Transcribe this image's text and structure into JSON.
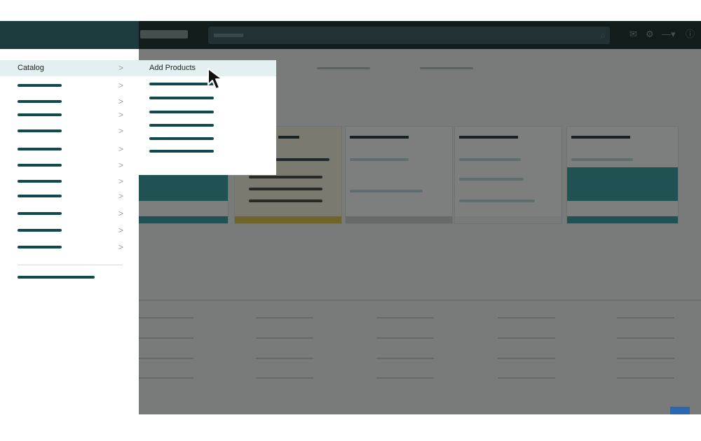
{
  "drawer": {
    "active_item": {
      "label": "Catalog",
      "chevron": ">"
    },
    "items": [
      {
        "chevron": ">"
      },
      {
        "chevron": ">"
      },
      {
        "chevron": ">"
      },
      {
        "chevron": ">"
      },
      {
        "chevron": ">"
      },
      {
        "chevron": ">"
      },
      {
        "chevron": ">"
      },
      {
        "chevron": ">"
      },
      {
        "chevron": ">"
      },
      {
        "chevron": ">"
      },
      {
        "chevron": ">"
      }
    ]
  },
  "submenu": {
    "highlighted_item": {
      "label": "Add Products"
    },
    "item_count": 6
  },
  "icons": {
    "search": "search-icon",
    "mail": "mail-icon",
    "settings": "gear-icon",
    "cursor": "mouse-pointer-icon"
  },
  "colors": {
    "drawer_header": "#1b3b3d",
    "accent_teal": "#104a4e",
    "highlight": "#e3eff1",
    "card_fill": "#3c9ea0",
    "card_yellow": "#e1c34a",
    "help_button": "#2b68b0"
  }
}
